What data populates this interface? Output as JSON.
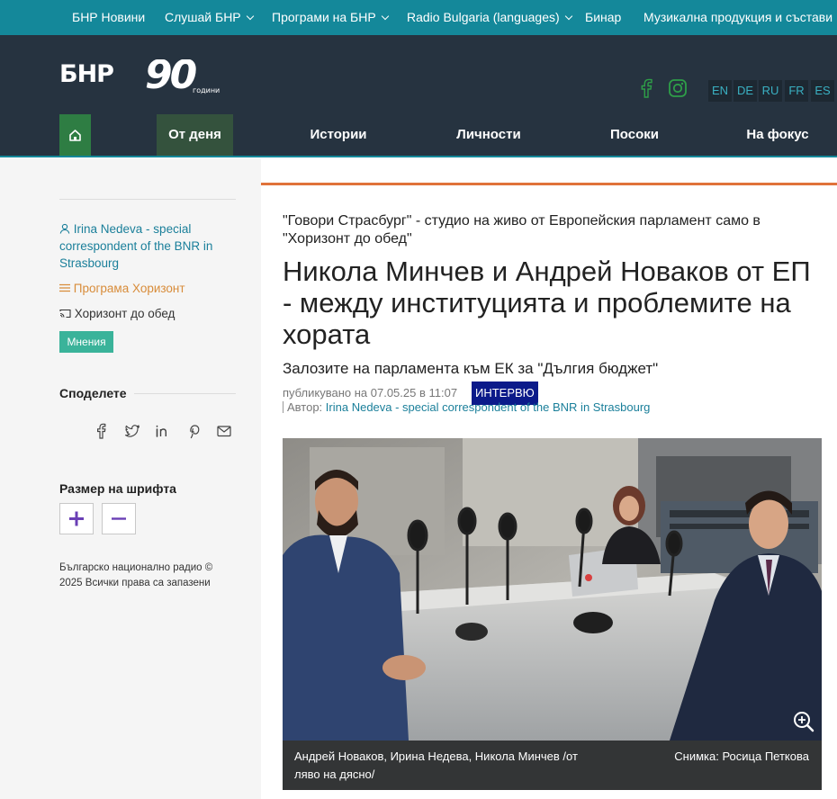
{
  "topnav": {
    "items": [
      {
        "label": "БНР Новини",
        "dropdown": false
      },
      {
        "label": "Слушай БНР",
        "dropdown": true
      },
      {
        "label": "Програми на БНР",
        "dropdown": true
      },
      {
        "label": "Radio Bulgaria (languages)",
        "dropdown": true
      },
      {
        "label": "Бинар",
        "dropdown": false
      },
      {
        "label": "Музикална продукция и състави",
        "dropdown": false
      }
    ]
  },
  "header": {
    "logo_text": "БНР",
    "logo_number": "90",
    "logo_sub": "години",
    "languages": [
      "EN",
      "DE",
      "RU",
      "FR",
      "ES"
    ],
    "nav": [
      "От деня",
      "Истории",
      "Личности",
      "Посоки",
      "На фокус"
    ]
  },
  "sidebar": {
    "author": "Irina Nedeva - special correspondent of the BNR in Strasbourg",
    "program": "Програма Хоризонт",
    "show": "Хоризонт до обед",
    "badge": "Мнения",
    "share_title": "Споделете",
    "font_size_title": "Размер на шрифта",
    "copyright": "Българско национално радио © 2025 Всички права са запазени"
  },
  "article": {
    "kicker": "\"Говори Страсбург\" - студио на живо от Европейския парламент само в \"Хоризонт до обед\"",
    "headline": "Никола Минчев и Андрей Новаков от ЕП - между институцията и проблемите на хората",
    "subtitle": "Залозите на парламента към ЕК за \"Дългия бюджет\"",
    "published": "публикувано на 07.05.25 в 11:07",
    "category": "ИНТЕРВЮ",
    "author_label": "Автор:",
    "author_name": "Irina Nedeva - special correspondent of the BNR in Strasbourg",
    "photo_caption": "Андрей Новаков, Ирина Недева, Никола Минчев /от ляво на дясно/",
    "photo_credit": "Снимка: Росица Петкова"
  },
  "colors": {
    "topbar": "#14889a",
    "header": "#263340",
    "home_green": "#2e7d43",
    "active_tab": "#34523d",
    "social_green": "#2e9e48",
    "link_teal": "#1a7f9a",
    "program_orange": "#d88c3a",
    "badge_teal": "#3ab39a",
    "accent_orange": "#e0723a",
    "interview_blue": "#0b1a8a",
    "font_btn_purple": "#6a3fb5"
  }
}
